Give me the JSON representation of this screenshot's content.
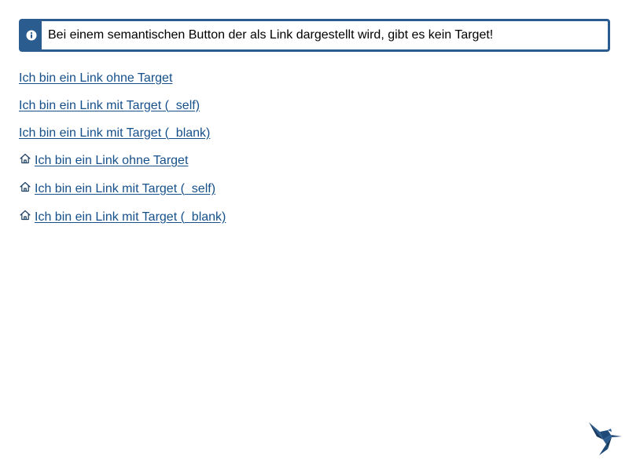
{
  "alert": {
    "icon": "info-icon",
    "text": "Bei einem semantischen Button der als Link dargestellt wird, gibt es kein Target!"
  },
  "links": [
    {
      "label": "Ich bin ein Link ohne Target",
      "icon": null
    },
    {
      "label": "Ich bin ein Link mit Target (_self)",
      "icon": null
    },
    {
      "label": "Ich bin ein Link mit Target (_blank)",
      "icon": null
    },
    {
      "label": "Ich bin ein Link ohne Target",
      "icon": "home-icon"
    },
    {
      "label": "Ich bin ein Link mit Target (_self)",
      "icon": "home-icon"
    },
    {
      "label": "Ich bin ein Link mit Target (_blank)",
      "icon": "home-icon"
    }
  ],
  "logo": {
    "icon": "hummingbird-logo"
  },
  "colors": {
    "accent": "#2b5c8f",
    "link": "#16508b"
  }
}
